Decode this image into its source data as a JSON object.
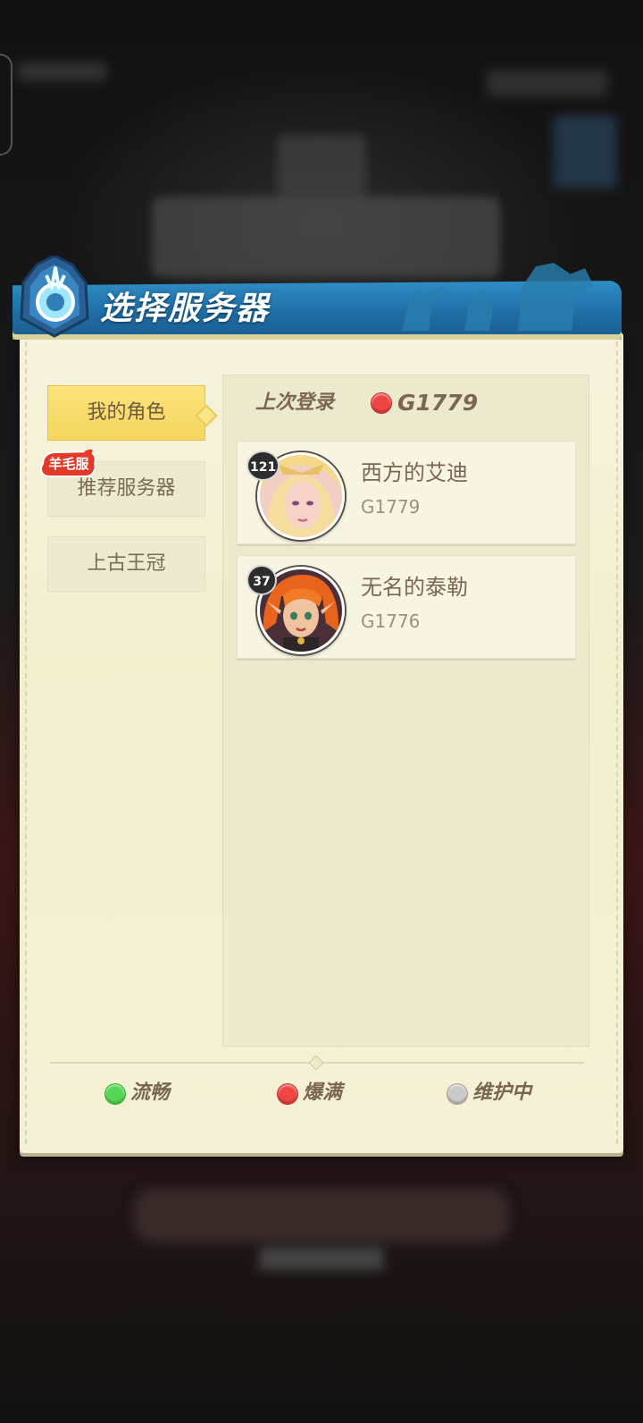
{
  "dialog": {
    "title": "选择服务器"
  },
  "tabs": [
    {
      "label": "我的角色",
      "active": true
    },
    {
      "label": "推荐服务器",
      "active": false,
      "badge": "羊毛服"
    },
    {
      "label": "上古王冠",
      "active": false
    }
  ],
  "last_login": {
    "label": "上次登录",
    "server": "G1779",
    "status": "full"
  },
  "roles": [
    {
      "level": "121",
      "name": "西方的艾迪",
      "server": "G1779"
    },
    {
      "level": "37",
      "name": "无名的泰勒",
      "server": "G1776"
    }
  ],
  "legend": [
    {
      "label": "流畅",
      "color": "#55d655"
    },
    {
      "label": "爆满",
      "color": "#ee4444"
    },
    {
      "label": "维护中",
      "color": "#c9c9c9"
    }
  ],
  "colors": {
    "banner": "#1f6ea6",
    "paper": "#f4f1d6",
    "active_tab": "#f6d660",
    "text_brown": "#7a6652"
  }
}
